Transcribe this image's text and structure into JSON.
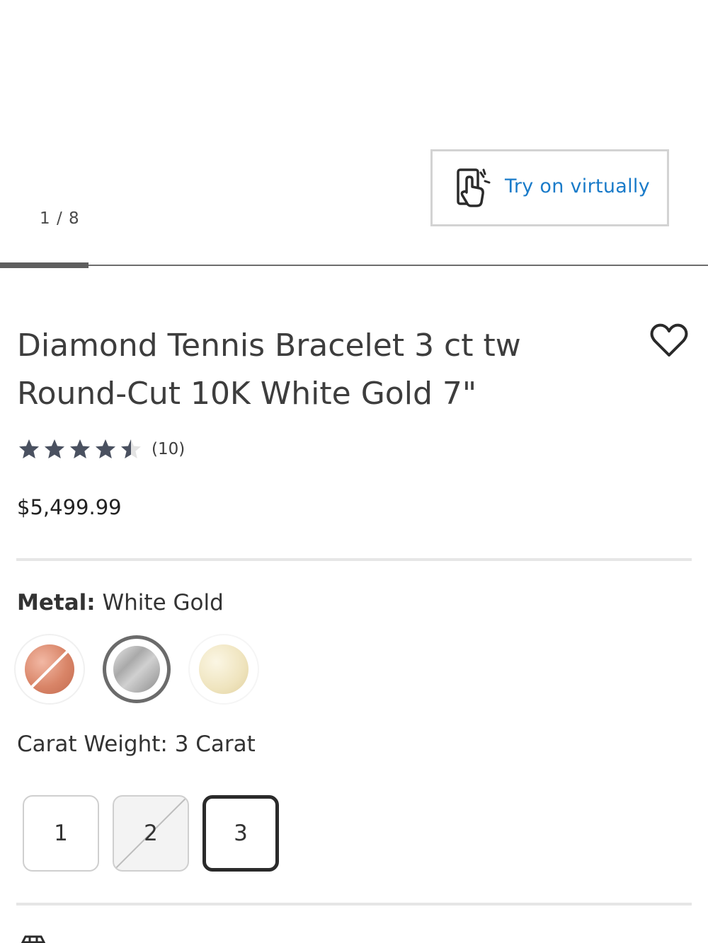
{
  "gallery": {
    "try_on_label": "Try on virtually",
    "counter": "1 / 8",
    "current_image": 1,
    "total_images": 8
  },
  "product": {
    "title": "Diamond Tennis Bracelet 3 ct tw Round-Cut 10K White Gold 7\"",
    "rating_value": 4.5,
    "rating_max": 5,
    "review_count": "(10)",
    "price": "$5,499.99"
  },
  "metal": {
    "label": "Metal:",
    "selected": "White Gold",
    "options": [
      {
        "name": "Rose Gold",
        "available": false
      },
      {
        "name": "White Gold",
        "available": true,
        "selected": true
      },
      {
        "name": "Yellow Gold",
        "available": true
      }
    ]
  },
  "carat": {
    "label": "Carat Weight:",
    "selected": "3 Carat",
    "options": [
      {
        "value": "1",
        "available": true
      },
      {
        "value": "2",
        "available": false
      },
      {
        "value": "3",
        "available": true,
        "selected": true
      }
    ]
  },
  "colors": {
    "accent_link": "#1a7bc9",
    "star": "#4a5160"
  }
}
